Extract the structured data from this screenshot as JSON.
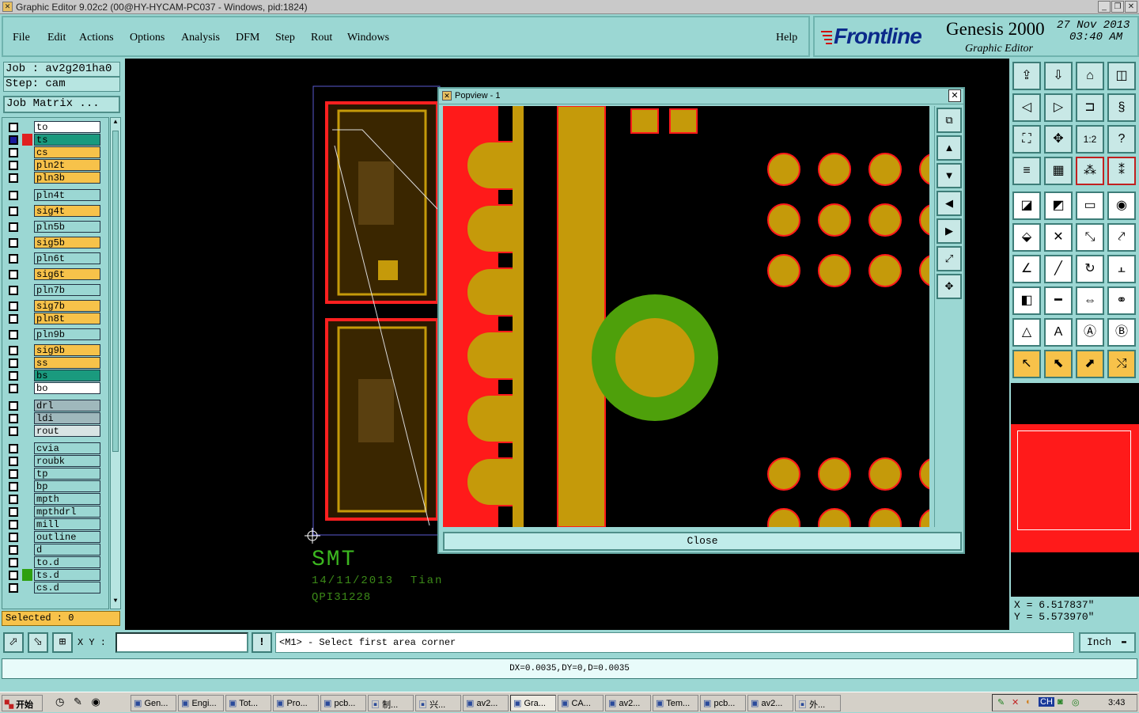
{
  "window": {
    "title": "Graphic Editor 9.02c2 (00@HY-HYCAM-PC037 - Windows, pid:1824)"
  },
  "menu": {
    "file": "File",
    "edit": "Edit",
    "actions": "Actions",
    "options": "Options",
    "analysis": "Analysis",
    "dfm": "DFM",
    "step": "Step",
    "rout": "Rout",
    "windows": "Windows",
    "help": "Help"
  },
  "brand": {
    "logo": "Frontline",
    "product": "Genesis 2000",
    "subtitle": "Graphic Editor",
    "date": "27 Nov 2013",
    "time": "03:40 AM"
  },
  "job": {
    "job_label": "Job : av2g201ha0",
    "step_label": "Step: cam",
    "matrix_button": "Job Matrix ..."
  },
  "layers": [
    {
      "name": "to",
      "color": "#ffffff"
    },
    {
      "name": "ts",
      "color": "#1a9a7e",
      "active": true
    },
    {
      "name": "cs",
      "color": "#f7c24a"
    },
    {
      "name": "pln2t",
      "color": "#f7c24a"
    },
    {
      "name": "pln3b",
      "color": "#f7c24a"
    },
    {
      "name": "pln4t",
      "color": "#9bd7d3"
    },
    {
      "name": "sig4t",
      "color": "#f7c24a"
    },
    {
      "name": "pln5b",
      "color": "#9bd7d3"
    },
    {
      "name": "sig5b",
      "color": "#f7c24a"
    },
    {
      "name": "pln6t",
      "color": "#9bd7d3"
    },
    {
      "name": "sig6t",
      "color": "#f7c24a"
    },
    {
      "name": "pln7b",
      "color": "#9bd7d3"
    },
    {
      "name": "sig7b",
      "color": "#f7c24a"
    },
    {
      "name": "pln8t",
      "color": "#f7c24a"
    },
    {
      "name": "pln9b",
      "color": "#9bd7d3"
    },
    {
      "name": "sig9b",
      "color": "#f7c24a"
    },
    {
      "name": "ss",
      "color": "#f7c24a"
    },
    {
      "name": "bs",
      "color": "#1a9a7e"
    },
    {
      "name": "bo",
      "color": "#ffffff"
    },
    {
      "name": "drl",
      "color": "#9fb8bc"
    },
    {
      "name": "ldi",
      "color": "#9fb8bc"
    },
    {
      "name": "rout",
      "color": "#d8e4e4"
    },
    {
      "name": "cvia",
      "color": "#9bd7d3"
    },
    {
      "name": "roubk",
      "color": "#9bd7d3"
    },
    {
      "name": "tp",
      "color": "#9bd7d3"
    },
    {
      "name": "bp",
      "color": "#9bd7d3"
    },
    {
      "name": "mpth",
      "color": "#9bd7d3"
    },
    {
      "name": "mpthdrl",
      "color": "#9bd7d3"
    },
    {
      "name": "mill",
      "color": "#9bd7d3"
    },
    {
      "name": "outline",
      "color": "#9bd7d3"
    },
    {
      "name": "d",
      "color": "#9bd7d3"
    },
    {
      "name": "to.d",
      "color": "#9bd7d3"
    },
    {
      "name": "ts.d",
      "color": "#9bd7d3"
    },
    {
      "name": "cs.d",
      "color": "#9bd7d3"
    }
  ],
  "selected": "Selected : 0",
  "canvas": {
    "smt": "SMT",
    "date_text": "14/11/2013  Tian",
    "code": "QPI31228"
  },
  "popview": {
    "title": "Popview - 1",
    "close_button": "Close"
  },
  "coords": {
    "x": "X = 6.517837\"",
    "y": "Y = 5.573970\""
  },
  "cmd": {
    "xy_label": "X Y :",
    "xy_value": "",
    "prompt": "<M1> - Select first area corner",
    "unit": "Inch"
  },
  "status": "DX=0.0035,DY=0,D=0.0035",
  "taskbar": {
    "start": "开始",
    "tasks": [
      "Gen...",
      "Engi...",
      "Tot...",
      "Pro...",
      "pcb...",
      "制...",
      "兴...",
      "av2...",
      "Gra...",
      "CA...",
      "av2...",
      "Tem...",
      "pcb...",
      "av2...",
      "外..."
    ],
    "clock": "3:43",
    "lang": "CH"
  },
  "colors": {
    "bg": "#9bd7d3",
    "copper": "#c59a0a",
    "red": "#ff1a1a",
    "green": "#4ea00b"
  }
}
